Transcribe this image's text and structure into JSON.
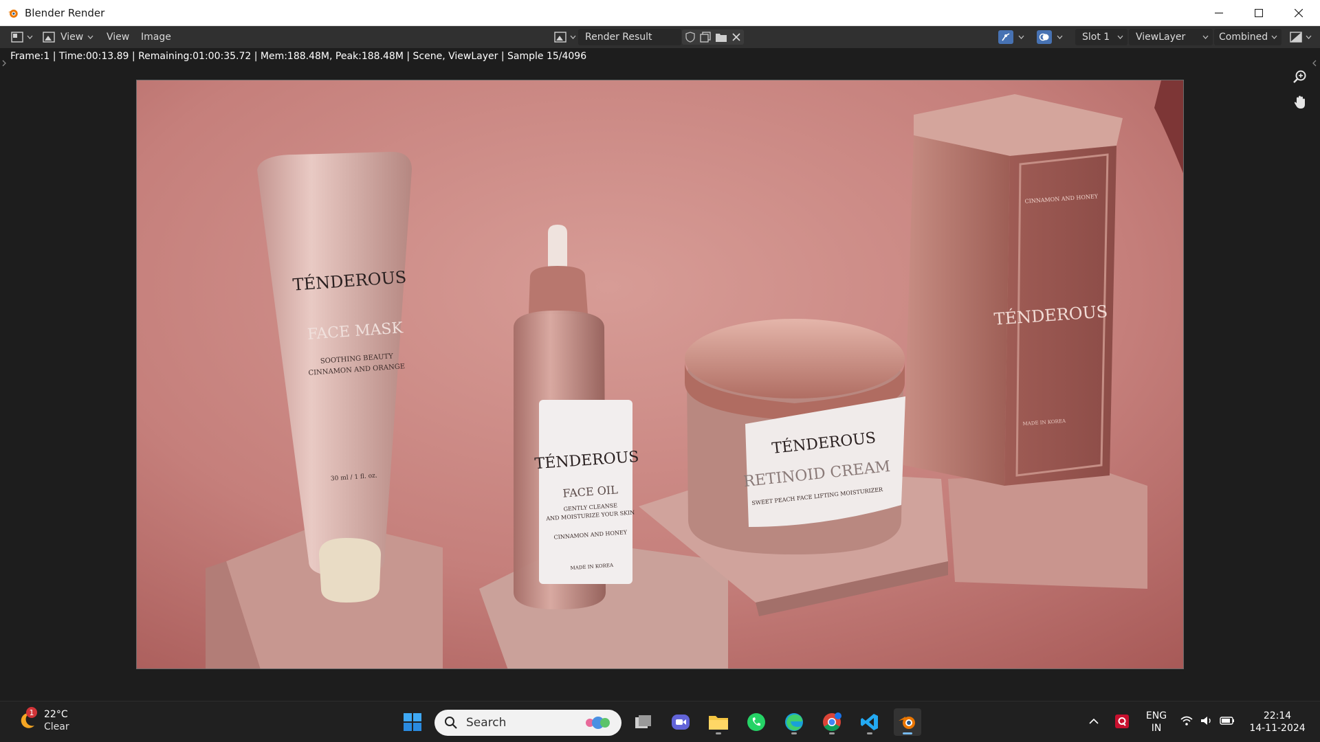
{
  "window": {
    "title": "Blender Render"
  },
  "header": {
    "menu": [
      "View",
      "View",
      "Image"
    ],
    "image_name": "Render Result",
    "slot": "Slot 1",
    "view_layer": "ViewLayer",
    "pass": "Combined"
  },
  "stats": {
    "text": "Frame:1 | Time:00:13.89 | Remaining:01:00:35.72 | Mem:188.48M, Peak:188.48M | Scene, ViewLayer | Sample 15/4096"
  },
  "render": {
    "tube": {
      "brand": "TÉNDEROUS",
      "product": "FACE MASK",
      "lines": [
        "SOOTHING BEAUTY",
        "CINNAMON AND ORANGE"
      ],
      "size": "30 ml / 1 fl. oz."
    },
    "bottle": {
      "brand": "TÉNDEROUS",
      "product": "FACE OIL",
      "lines": [
        "GENTLY CLEANSE",
        "AND MOISTURIZE YOUR SKIN",
        "CINNAMON AND HONEY"
      ],
      "footer": "MADE IN KOREA"
    },
    "jar": {
      "brand": "TÉNDEROUS",
      "product": "RETINOID CREAM",
      "lines": [
        "SWEET PEACH FACE LIFTING MOISTURIZER"
      ]
    },
    "box": {
      "brand": "TÉNDEROUS",
      "top_line": "CINNAMON AND HONEY",
      "footer": "MADE IN KOREA"
    }
  },
  "taskbar": {
    "weather": {
      "temp": "22°C",
      "condition": "Clear",
      "badge": "1"
    },
    "search_placeholder": "Search",
    "lang": [
      "ENG",
      "IN"
    ],
    "time": "22:14",
    "date": "14-11-2024"
  }
}
